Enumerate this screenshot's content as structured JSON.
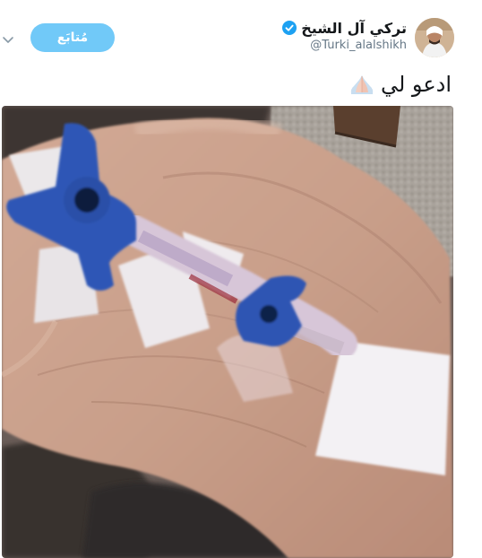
{
  "tweet": {
    "display_name": "تركي آل الشيخ",
    "handle": "@Turki_alalshikh",
    "follow_label": "مُتابَع",
    "text": "ادعو لي",
    "emoji": "folded-hands",
    "verified": true,
    "verified_color": "#1da1f2",
    "follow_button_color": "#71c9f8"
  },
  "icons": {
    "menu": "chevron-down-icon",
    "verified": "verified-badge-icon",
    "emoji": "folded-hands-icon"
  },
  "media": {
    "description_colors": {
      "skin": "#c59b84",
      "connector_blue": "#2d56b5",
      "floor": "#b1aba3"
    }
  }
}
